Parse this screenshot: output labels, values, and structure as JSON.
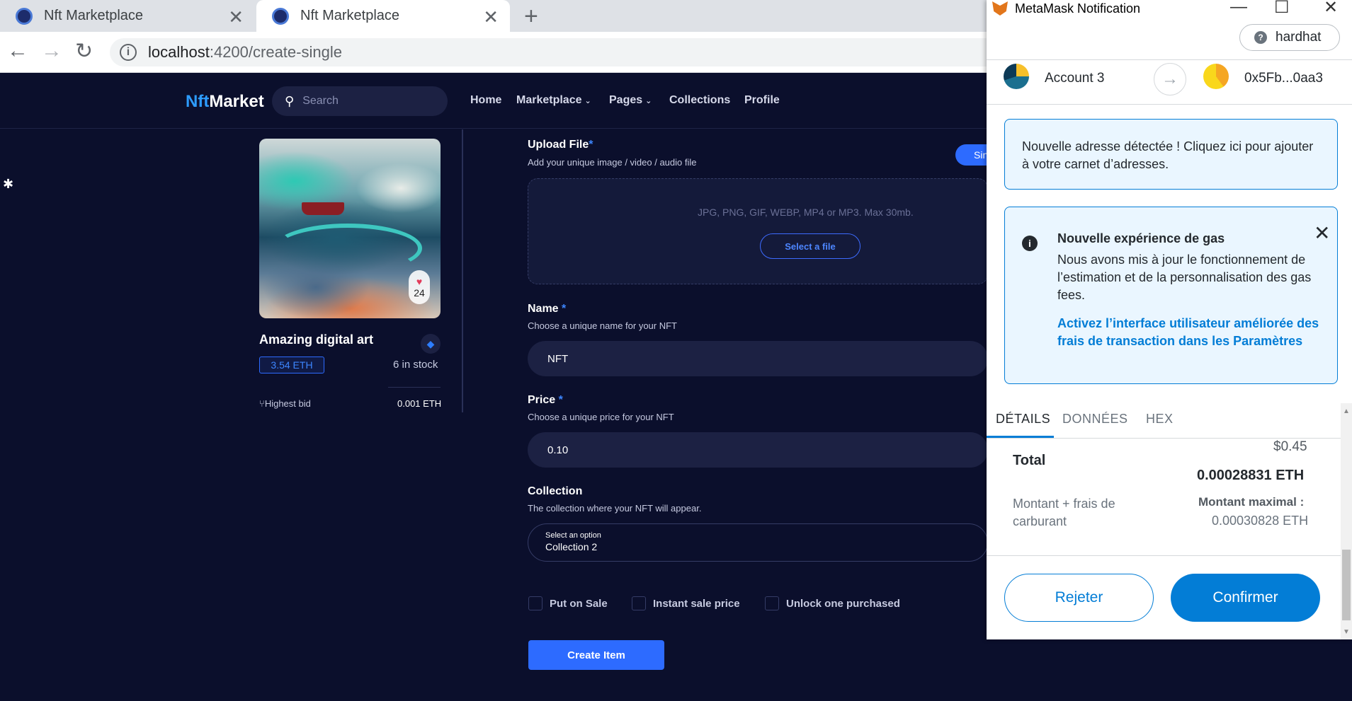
{
  "browser": {
    "tabs": [
      {
        "title": "Nft Marketplace"
      },
      {
        "title": "Nft Marketplace"
      }
    ],
    "url_host": "localhost",
    "url_path": ":4200/create-single"
  },
  "site": {
    "logo_prefix": "Nft",
    "logo_suffix": "Market",
    "search_placeholder": "Search",
    "nav": [
      "Home",
      "Marketplace",
      "Pages",
      "Collections",
      "Profile"
    ]
  },
  "nft_card": {
    "likes": "24",
    "title": "Amazing digital art",
    "price": "3.54 ETH",
    "stock": "6 in stock",
    "highest_bid_label": "Highest bid",
    "highest_bid_value": "0.001 ETH"
  },
  "form": {
    "upload_label": "Upload File",
    "upload_hint": "Add your unique image / video / audio file",
    "single_pill": "Sin",
    "upload_types": "JPG, PNG, GIF, WEBP, MP4 or MP3. Max 30mb.",
    "select_file": "Select a file",
    "name_label": "Name",
    "name_hint": "Choose a unique name for your NFT",
    "name_value": "NFT",
    "price_label": "Price",
    "price_hint": "Choose a unique price for your NFT",
    "price_value": "0.10",
    "collection_label": "Collection",
    "collection_hint": "The collection where your NFT will appear.",
    "collection_caption": "Select an option",
    "collection_value": "Collection 2",
    "checkboxes": [
      "Put on Sale",
      "Instant sale price",
      "Unlock one purchased"
    ],
    "create_button": "Create Item",
    "required_mark": "*"
  },
  "metamask": {
    "window_title": "MetaMask Notification",
    "network": "hardhat",
    "from_account": "Account 3",
    "to_address": "0x5Fb...0aa3",
    "new_address_notice": "Nouvelle adresse détectée ! Cliquez ici pour ajouter à votre carnet d’adresses.",
    "gas_title": "Nouvelle expérience de gas",
    "gas_body": "Nous avons mis à jour le fonctionnement de l’estimation et de la personnalisation des gas fees.",
    "gas_link": "Activez l’interface utilisateur améliorée des frais de transaction dans les Paramètres",
    "tabs": [
      "DÉTAILS",
      "DONNÉES",
      "HEX"
    ],
    "total_usd": "$0.45",
    "total_label": "Total",
    "total_eth": "0.00028831 ETH",
    "sum_label": "Montant + frais de carburant",
    "max_label": "Montant maximal :",
    "max_value": "0.00030828 ETH",
    "reject": "Rejeter",
    "confirm": "Confirmer"
  },
  "colors": {
    "site_bg": "#0b0f2c",
    "accent_blue": "#2d6bff",
    "metamask_blue": "#037dd6"
  }
}
